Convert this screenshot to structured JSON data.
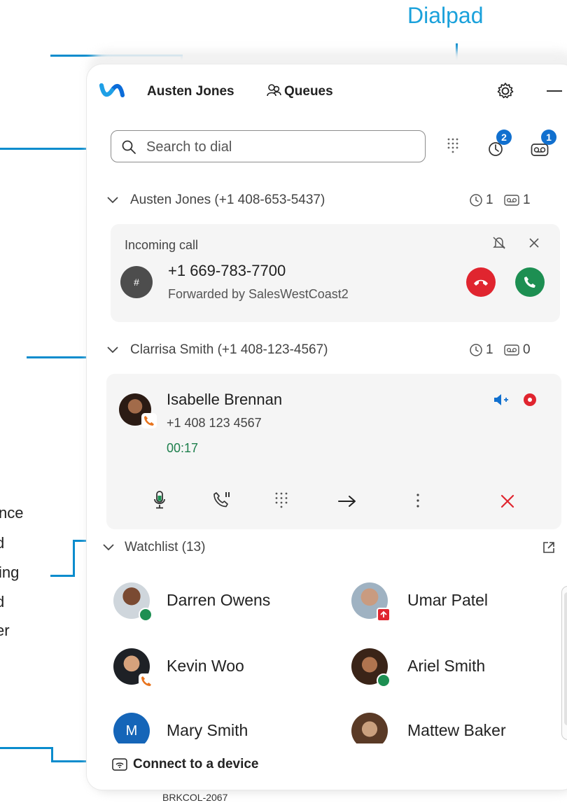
{
  "annotations": {
    "dialpad_title": "Dialpad",
    "side_lines": [
      "nce",
      "d",
      "ing",
      "d",
      "er"
    ]
  },
  "header": {
    "user_name": "Austen Jones",
    "queues_label": "Queues"
  },
  "search": {
    "placeholder": "Search to dial"
  },
  "toolbar": {
    "recents_badge": "2",
    "voicemail_badge": "1"
  },
  "lines": [
    {
      "label": "Austen Jones (+1 408-653-5437)",
      "recent_count": "1",
      "voicemail_count": "1",
      "incoming": {
        "title": "Incoming call",
        "number": "+1 669-783-7700",
        "forwarded": "Forwarded by SalesWestCoast2",
        "avatar_symbol": "#"
      }
    },
    {
      "label": "Clarrisa Smith (+1 408-123-4567)",
      "recent_count": "1",
      "voicemail_count": "0",
      "active_call": {
        "name": "Isabelle Brennan",
        "number": "+1 408 123 4567",
        "timer": "00:17"
      }
    }
  ],
  "watchlist": {
    "label": "Watchlist (13)",
    "contacts": [
      {
        "name": "Darren Owens",
        "presence": "available"
      },
      {
        "name": "Umar Patel",
        "presence": "presenting"
      },
      {
        "name": "Kevin Woo",
        "presence": "on-call"
      },
      {
        "name": "Ariel Smith",
        "presence": "available"
      },
      {
        "name": "Mary Smith",
        "initial": "M"
      },
      {
        "name": "Mattew Baker"
      }
    ]
  },
  "footer": {
    "connect_label": "Connect to a device"
  },
  "session_code": "BRKCOL-2067",
  "colors": {
    "accent": "#1170cf",
    "callout": "#0a8ccd",
    "decline": "#e0252f",
    "answer": "#1d8f52",
    "available": "#1d8f52",
    "on_call": "#e8741e",
    "end": "#e0252f"
  }
}
